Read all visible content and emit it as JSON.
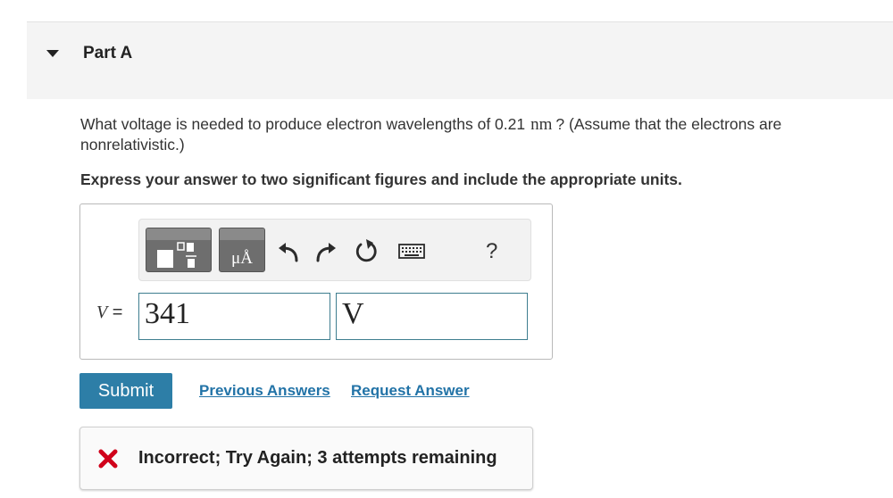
{
  "part": {
    "title": "Part A"
  },
  "question": {
    "text_before": "What voltage is needed to produce electron wavelengths of 0.21",
    "unit": "nm",
    "text_after": "? (Assume that the electrons are nonrelativistic.)"
  },
  "instruction": "Express your answer to two significant figures and include the appropriate units.",
  "toolbar": {
    "templates_icon": "templates-icon",
    "units_label": "μÅ",
    "undo_icon": "undo-icon",
    "redo_icon": "redo-icon",
    "reset_icon": "reset-icon",
    "keyboard_icon": "keyboard-icon",
    "help_label": "?"
  },
  "answer": {
    "variable": "V",
    "equals": "=",
    "value": "341",
    "units": "V"
  },
  "actions": {
    "submit": "Submit",
    "previous_answers": "Previous Answers",
    "request_answer": "Request Answer"
  },
  "feedback": {
    "icon": "incorrect-x-icon",
    "icon_color": "#d0021b",
    "message": "Incorrect; Try Again; 3 attempts remaining"
  }
}
